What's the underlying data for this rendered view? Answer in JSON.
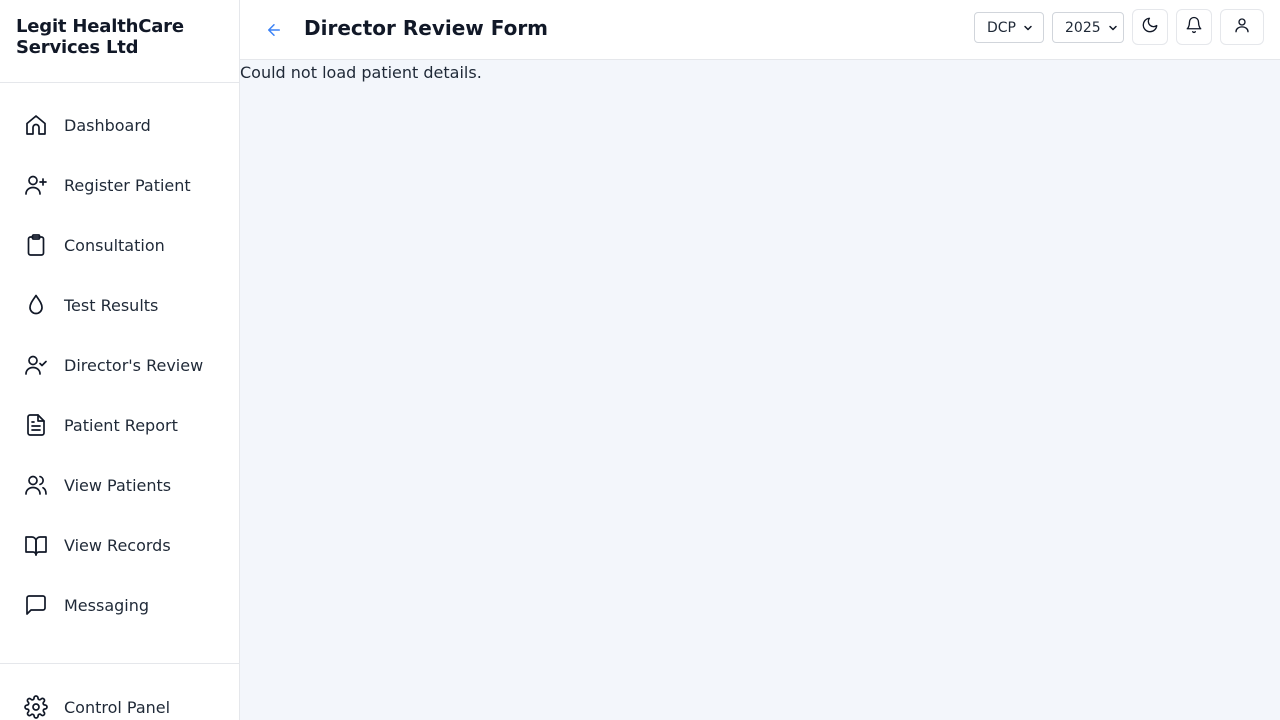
{
  "app": {
    "brand": "Legit HealthCare Services Ltd"
  },
  "sidebar": {
    "items": [
      {
        "label": "Dashboard",
        "icon": "home-icon"
      },
      {
        "label": "Register Patient",
        "icon": "user-plus-icon"
      },
      {
        "label": "Consultation",
        "icon": "clipboard-icon"
      },
      {
        "label": "Test Results",
        "icon": "droplet-icon"
      },
      {
        "label": "Director's Review",
        "icon": "user-check-icon"
      },
      {
        "label": "Patient Report",
        "icon": "file-text-icon"
      },
      {
        "label": "View Patients",
        "icon": "users-icon"
      },
      {
        "label": "View Records",
        "icon": "book-open-icon"
      },
      {
        "label": "Messaging",
        "icon": "message-square-icon"
      }
    ],
    "bottom": {
      "label": "Control Panel",
      "icon": "gear-icon"
    }
  },
  "header": {
    "title": "Director Review Form",
    "org_select": {
      "value": "DCP"
    },
    "year_select": {
      "value": "2025"
    },
    "accent": "#3b82f6"
  },
  "main": {
    "message": "Could not load patient details."
  }
}
